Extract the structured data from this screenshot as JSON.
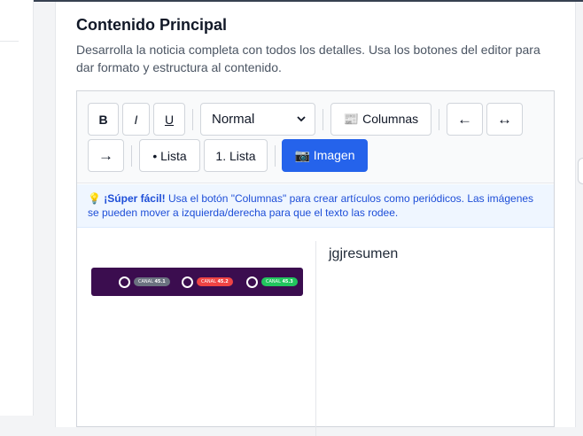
{
  "section": {
    "title": "Contenido Principal",
    "description": "Desarrolla la noticia completa con todos los detalles. Usa los botones del editor para dar formato y estructura al contenido."
  },
  "toolbar": {
    "bold": "B",
    "italic": "I",
    "underline": "U",
    "format_select": "Normal",
    "columns": "📰 Columnas",
    "align_left": "←",
    "align_center": "↔",
    "align_right": "→",
    "bullet_list": "• Lista",
    "numbered_list": "1. Lista",
    "image": "📷 Imagen"
  },
  "tip": {
    "icon": "💡",
    "strong": "¡Súper fácil!",
    "text": " Usa el botón \"Columnas\" para crear artículos como periódicos. Las imágenes se pueden mover a izquierda/derecha para que el texto las rodee."
  },
  "content": {
    "right_column_text": "jgjresumen",
    "banner": {
      "background": "#3b0d4f",
      "channels": [
        {
          "label": "CANAL",
          "value": "45.1",
          "color": "#6b7280"
        },
        {
          "label": "CANAL",
          "value": "45.2",
          "color": "#ef4444"
        },
        {
          "label": "CANAL",
          "value": "45.3",
          "color": "#22c55e"
        }
      ]
    }
  },
  "colors": {
    "primary": "#2563eb",
    "tip_bg": "#eff6ff",
    "tip_text": "#1d4ed8"
  }
}
